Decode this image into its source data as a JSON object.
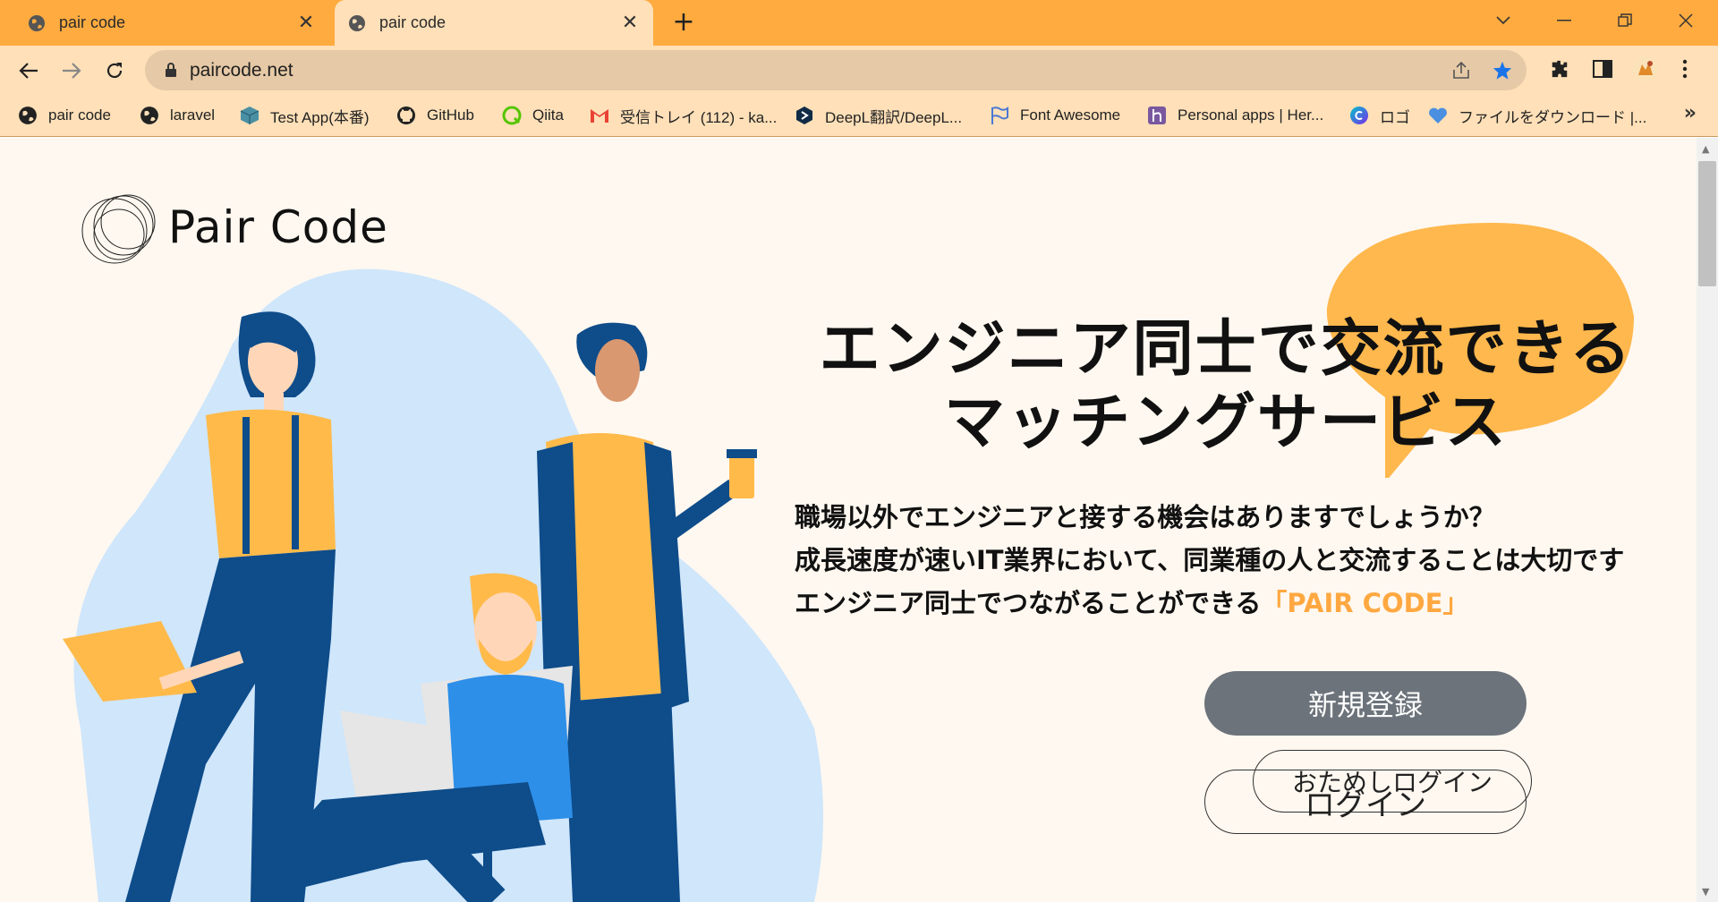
{
  "browser": {
    "tabs": [
      {
        "title": "pair code",
        "active": false
      },
      {
        "title": "pair code",
        "active": true
      }
    ],
    "url": "paircode.net",
    "bookmarks": [
      {
        "label": "pair code",
        "icon": "globe-icon"
      },
      {
        "label": "laravel",
        "icon": "globe-icon"
      },
      {
        "label": "Test App(本番)",
        "icon": "cube-icon"
      },
      {
        "label": "GitHub",
        "icon": "github-icon"
      },
      {
        "label": "Qiita",
        "icon": "qiita-icon"
      },
      {
        "label": "受信トレイ (112) - ka...",
        "icon": "gmail-icon"
      },
      {
        "label": "DeepL翻訳/DeepL...",
        "icon": "deepl-icon"
      },
      {
        "label": "Font Awesome",
        "icon": "flag-icon"
      },
      {
        "label": "Personal apps | Her...",
        "icon": "heroku-icon"
      },
      {
        "label": "ロゴ",
        "icon": "canva-icon"
      },
      {
        "label": "ファイルをダウンロード |...",
        "icon": "heart-icon"
      }
    ],
    "more_bookmarks": "»"
  },
  "page": {
    "logo_text": "Pair Code",
    "headline_line1": "エンジニア同士で交流できる",
    "headline_line2": "マッチングサービス",
    "desc_line1": "職場以外でエンジニアと接する機会はありますでしょうか？",
    "desc_line2": "成長速度が速いIT業界において、同業種の人と交流することは大切です",
    "desc_line3_prefix": "エンジニア同士でつながることができる",
    "desc_line3_brand": "「PAIR CODE」",
    "register_button": "新規登録",
    "trial_login_button": "おためしログイン",
    "login_button": "ログイン"
  },
  "colors": {
    "tabstrip": "#ffab40",
    "toolbar": "#ffe0b8",
    "accent_orange": "#ffa841",
    "bubble": "#ffb84d",
    "blob": "#cfe6fb",
    "register_button": "#6c737b"
  }
}
